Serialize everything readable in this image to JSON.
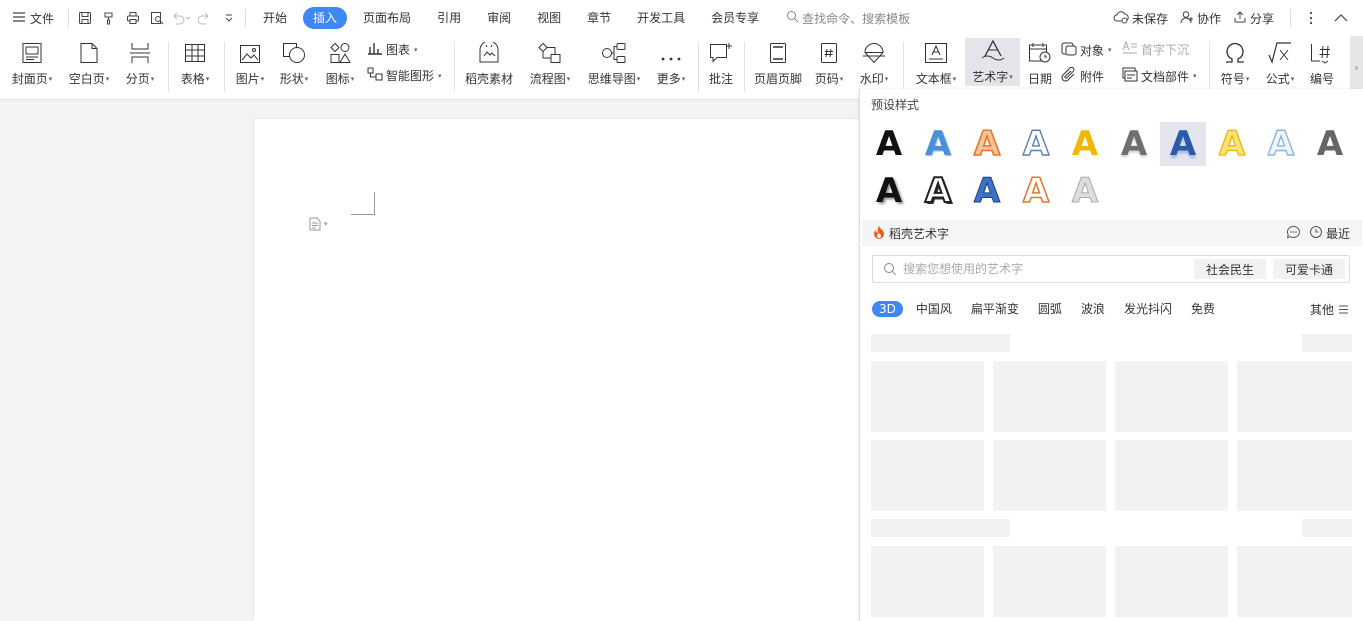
{
  "menubar": {
    "file_label": "文件",
    "tabs": [
      {
        "label": "开始"
      },
      {
        "label": "插入"
      },
      {
        "label": "页面布局"
      },
      {
        "label": "引用"
      },
      {
        "label": "审阅"
      },
      {
        "label": "视图"
      },
      {
        "label": "章节"
      },
      {
        "label": "开发工具"
      },
      {
        "label": "会员专享"
      }
    ],
    "active_tab": "插入",
    "search_text": "查找命令、搜索模板",
    "unsaved_label": "未保存",
    "collab_label": "协作",
    "share_label": "分享"
  },
  "ribbon": {
    "cover": "封面页",
    "blank": "空白页",
    "pagebreak": "分页",
    "table": "表格",
    "picture": "图片",
    "shape": "形状",
    "icon": "图标",
    "chart": "图表",
    "smartart": "智能图形",
    "daoke": "稻壳素材",
    "flowchart": "流程图",
    "mindmap": "思维导图",
    "more": "更多",
    "comment": "批注",
    "header_footer": "页眉页脚",
    "page_number": "页码",
    "watermark": "水印",
    "textbox": "文本框",
    "wordart": "艺术字",
    "date": "日期",
    "object": "对象",
    "attachment": "附件",
    "dropcap": "首字下沉",
    "docpart": "文档部件",
    "symbol": "符号",
    "formula": "公式",
    "numbering": "编号"
  },
  "panel": {
    "preset_title": "预设样式",
    "preset_letter": "A",
    "daoke_title": "稻壳艺术字",
    "recent_label": "最近",
    "search_placeholder": "搜索您想使用的艺术字",
    "search_tags": [
      "社会民生",
      "可爱卡通"
    ],
    "categories": [
      {
        "label": "3D"
      },
      {
        "label": "中国风"
      },
      {
        "label": "扁平渐变"
      },
      {
        "label": "圆弧"
      },
      {
        "label": "波浪"
      },
      {
        "label": "发光抖闪"
      },
      {
        "label": "免费"
      }
    ],
    "active_category": "3D",
    "other_label": "其他"
  },
  "colors": {
    "accent": "#3f87f5",
    "preset_orange": "#e8742a",
    "preset_gold": "#f2b705",
    "preset_blue": "#4a8fd8",
    "daoke_orange": "#f25c19"
  }
}
